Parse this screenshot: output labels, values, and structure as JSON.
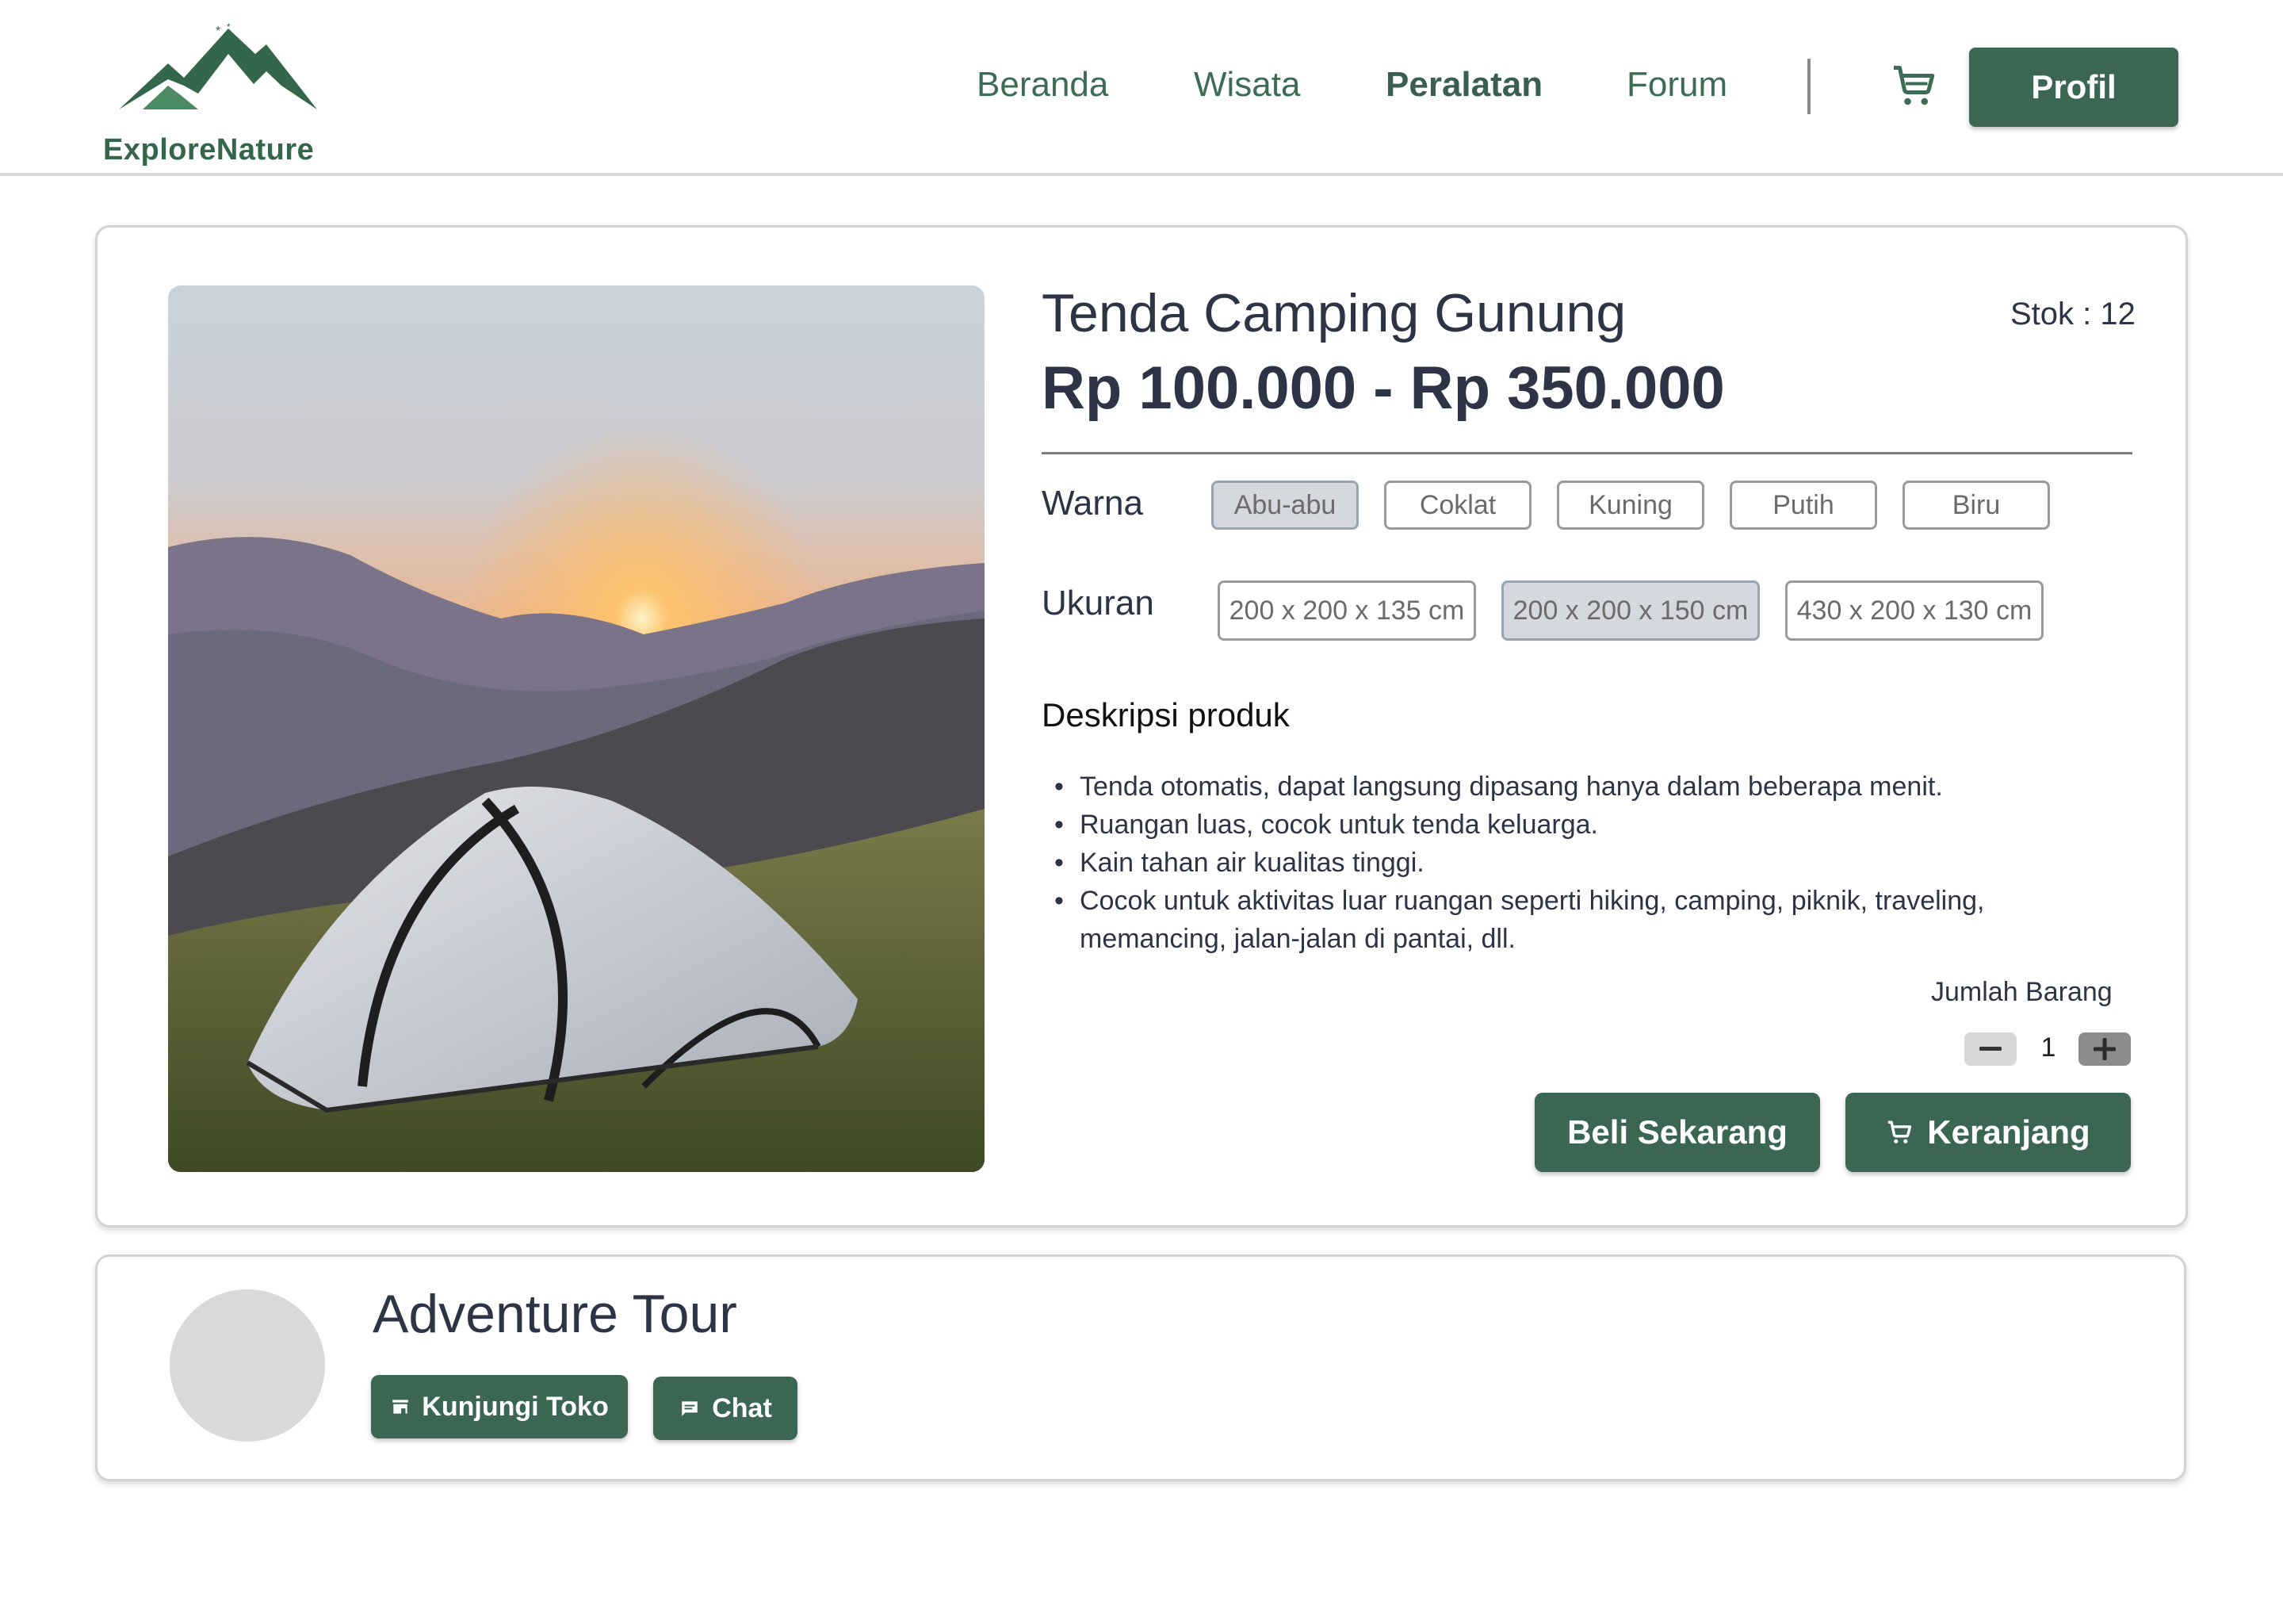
{
  "brand": {
    "name": "ExploreNature",
    "color": "#33664a"
  },
  "nav": {
    "links": [
      "Beranda",
      "Wisata",
      "Peralatan",
      "Forum"
    ],
    "active": "Peralatan",
    "profile_label": "Profil"
  },
  "product": {
    "title": "Tenda Camping Gunung",
    "stock": "Stok : 12",
    "price": "Rp 100.000 - Rp 350.000",
    "color_label": "Warna",
    "colors": [
      "Abu-abu",
      "Coklat",
      "Kuning",
      "Putih",
      "Biru"
    ],
    "selected_color": "Abu-abu",
    "size_label": "Ukuran",
    "sizes": [
      "200 x 200 x 135 cm",
      "200 x 200 x 150 cm",
      "430 x 200 x 130 cm"
    ],
    "selected_size": "200 x 200 x 150 cm",
    "description_title": "Deskripsi produk",
    "description": [
      "Tenda otomatis, dapat langsung dipasang hanya dalam beberapa menit.",
      "Ruangan luas, cocok untuk tenda keluarga.",
      "Kain tahan air kualitas tinggi.",
      "Cocok untuk aktivitas luar ruangan seperti hiking, camping, piknik, traveling, memancing, jalan-jalan di pantai, dll."
    ],
    "quantity_label": "Jumlah Barang",
    "quantity": "1",
    "buy_label": "Beli Sekarang",
    "cart_label": "Keranjang"
  },
  "shop": {
    "name": "Adventure Tour",
    "visit_label": "Kunjungi Toko",
    "chat_label": "Chat"
  },
  "colors": {
    "primary": "#3b6654",
    "text": "#2e3446",
    "chip_selected": "#d5d8de"
  }
}
